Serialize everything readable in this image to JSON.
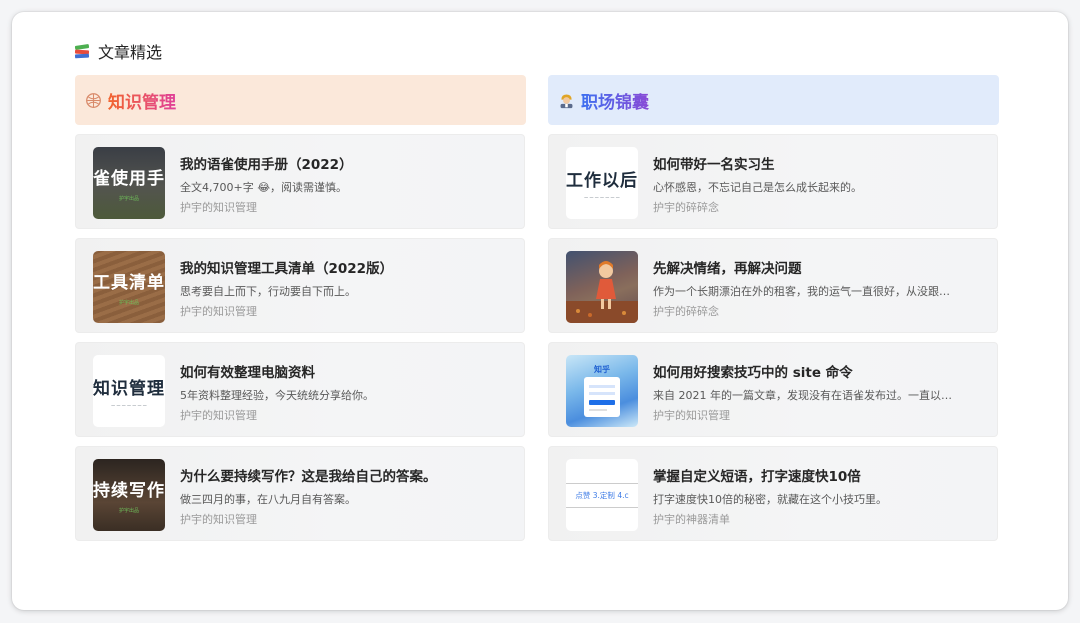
{
  "section": {
    "title": "文章精选",
    "icon": "books-icon"
  },
  "columns": [
    {
      "header": "知识管理",
      "icon": "brain-icon",
      "cards": [
        {
          "title": "我的语雀使用手册（2022）",
          "desc": "全文4,700+字 😂，阅读需谨慎。",
          "source": "护宇的知识管理",
          "thumb_text": "雀使用手",
          "thumb_sub": "护宇出品"
        },
        {
          "title": "我的知识管理工具清单（2022版）",
          "desc": "思考要自上而下，行动要自下而上。",
          "source": "护宇的知识管理",
          "thumb_text": "工具清单",
          "thumb_sub": "护宇出品"
        },
        {
          "title": "如何有效整理电脑资料",
          "desc": "5年资料整理经验，今天统统分享给你。",
          "source": "护宇的知识管理",
          "thumb_text": "知识管理"
        },
        {
          "title": "为什么要持续写作？这是我给自己的答案。",
          "desc": "做三四月的事，在八九月自有答案。",
          "source": "护宇的知识管理",
          "thumb_text": "持续写作",
          "thumb_sub": "护宇出品"
        }
      ]
    },
    {
      "header": "职场锦囊",
      "icon": "office-worker-icon",
      "cards": [
        {
          "title": "如何带好一名实习生",
          "desc": "心怀感恩，不忘记自己是怎么成长起来的。",
          "source": "护宇的碎碎念",
          "thumb_text": "工作以后"
        },
        {
          "title": "先解决情绪，再解决问题",
          "desc": "作为一个长期漂泊在外的租客，我的运气一直很好，从没跟房东…",
          "source": "护宇的碎碎念"
        },
        {
          "title": "如何用好搜索技巧中的 site 命令",
          "desc": "来自 2021 年的一篇文章，发现没有在语雀发布过。一直以来，…",
          "source": "护宇的知识管理",
          "thumb_text": "知乎"
        },
        {
          "title": "掌握自定义短语，打字速度快10倍",
          "desc": "打字速度快10倍的秘密，就藏在这个小技巧里。",
          "source": "护宇的神器清单",
          "thumb_text": "点赞  3.定制  4.c"
        }
      ]
    }
  ]
}
